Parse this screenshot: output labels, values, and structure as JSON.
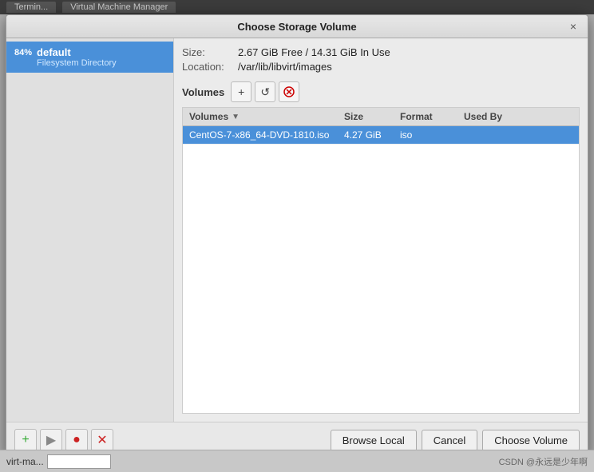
{
  "bg_bar": {
    "tabs": [
      "Termin...",
      "Virtual Machine Manager"
    ]
  },
  "dialog": {
    "title": "Choose Storage Volume",
    "close_label": "×"
  },
  "left_panel": {
    "pools": [
      {
        "percent": "84%",
        "name": "default",
        "type": "Filesystem Directory",
        "selected": true
      }
    ]
  },
  "right_panel": {
    "size_label": "Size:",
    "size_value": "2.67 GiB Free / 14.31 GiB In Use",
    "location_label": "Location:",
    "location_value": "/var/lib/libvirt/images",
    "volumes_label": "Volumes",
    "add_btn": "+",
    "refresh_btn": "↺",
    "delete_btn": "⊗",
    "table": {
      "headers": {
        "volumes": "Volumes",
        "size": "Size",
        "format": "Format",
        "used_by": "Used By"
      },
      "rows": [
        {
          "name": "CentOS-7-x86_64-DVD-1810.iso",
          "size": "4.27 GiB",
          "format": "iso",
          "used_by": "",
          "selected": true
        }
      ]
    }
  },
  "bottom_bar": {
    "icon_btns": [
      {
        "icon": "+",
        "color": "green",
        "name": "add"
      },
      {
        "icon": "▶",
        "color": "gray",
        "name": "play"
      },
      {
        "icon": "●",
        "color": "red",
        "name": "record"
      },
      {
        "icon": "⊗",
        "color": "red",
        "name": "stop"
      }
    ],
    "action_btns": [
      {
        "label": "Browse Local",
        "name": "browse-local"
      },
      {
        "label": "Cancel",
        "name": "cancel"
      },
      {
        "label": "Choose Volume",
        "name": "choose-volume"
      }
    ]
  },
  "status_bar": {
    "label": "virt-ma...",
    "watermark": "CSDN @永远是少年啊"
  }
}
